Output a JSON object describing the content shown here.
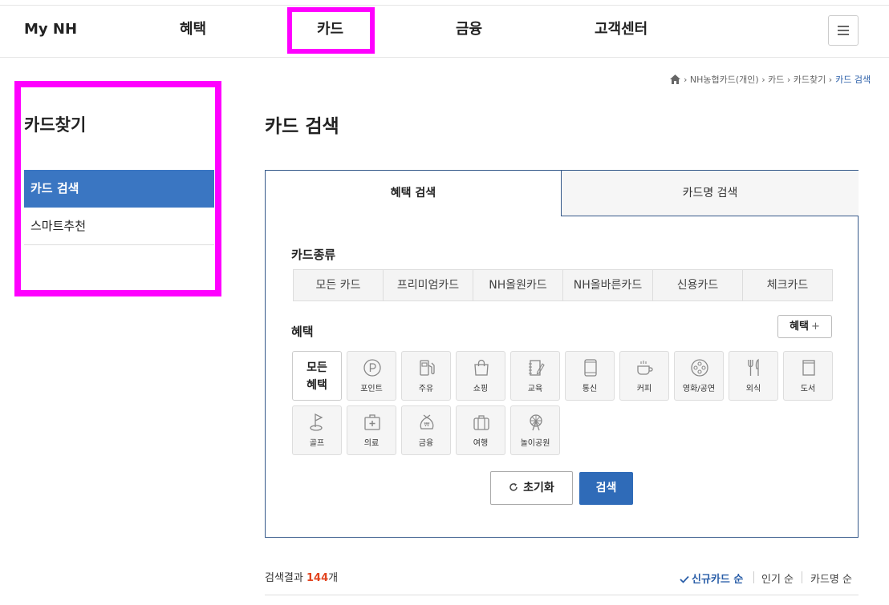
{
  "topnav": {
    "items": [
      "My NH",
      "혜택",
      "카드",
      "금융",
      "고객센터"
    ],
    "menu_icon": "hamburger-icon"
  },
  "sidebar": {
    "title": "카드찾기",
    "items": [
      "카드 검색",
      "스마트추천"
    ]
  },
  "breadcrumb": {
    "home_icon": "home-icon",
    "path": "› NH농협카드(개인) › 카드 › 카드찾기 ›",
    "current": "카드 검색"
  },
  "page_title": "카드 검색",
  "tabs": [
    "혜택 검색",
    "카드명 검색"
  ],
  "card_type": {
    "label": "카드종류",
    "options": [
      "모든 카드",
      "프리미엄카드",
      "NH올원카드",
      "NH올바른카드",
      "신용카드",
      "체크카드"
    ]
  },
  "benefit": {
    "label": "혜택",
    "add_button": "혜택",
    "add_symbol": "+",
    "all_line1": "모든",
    "all_line2": "혜택",
    "tiles": [
      {
        "label": "포인트",
        "icon": "point-icon"
      },
      {
        "label": "주유",
        "icon": "fuel-icon"
      },
      {
        "label": "쇼핑",
        "icon": "shopping-bag-icon"
      },
      {
        "label": "교육",
        "icon": "notebook-icon"
      },
      {
        "label": "통신",
        "icon": "tablet-icon"
      },
      {
        "label": "커피",
        "icon": "coffee-icon"
      },
      {
        "label": "영화/공연",
        "icon": "film-reel-icon"
      },
      {
        "label": "외식",
        "icon": "fork-knife-icon"
      },
      {
        "label": "도서",
        "icon": "book-icon"
      },
      {
        "label": "골프",
        "icon": "golf-icon"
      },
      {
        "label": "의료",
        "icon": "medical-kit-icon"
      },
      {
        "label": "금융",
        "icon": "money-bag-icon"
      },
      {
        "label": "여행",
        "icon": "suitcase-icon"
      },
      {
        "label": "놀이공원",
        "icon": "ferris-wheel-icon"
      }
    ]
  },
  "actions": {
    "reset": "초기화",
    "reset_icon": "refresh-icon",
    "search": "검색"
  },
  "results": {
    "prefix": "검색결과",
    "count": "144",
    "suffix": "개",
    "sort": [
      "신규카드 순",
      "인기 순",
      "카드명 순"
    ],
    "sort_check_icon": "check-icon"
  },
  "colors": {
    "primary": "#3a76c2",
    "highlight": "#ff00ff",
    "count": "#e2441f"
  }
}
